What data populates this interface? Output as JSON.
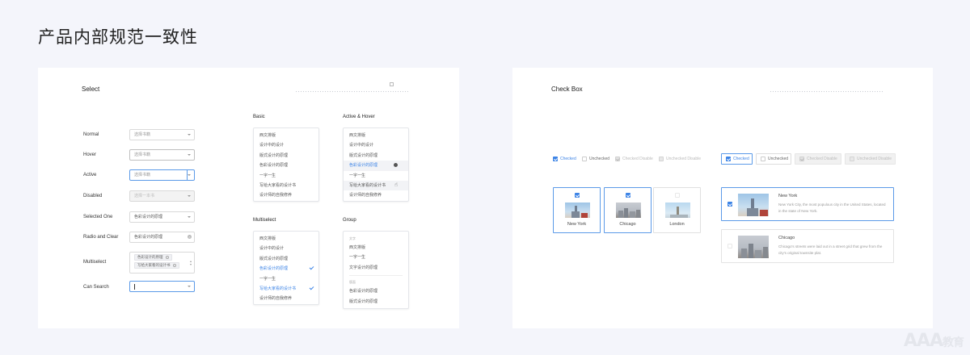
{
  "page_title": "产品内部规范一致性",
  "select_panel": {
    "title": "Select",
    "rows": [
      {
        "label": "Normal",
        "value": "选择书籍"
      },
      {
        "label": "Hover",
        "value": "选择书籍"
      },
      {
        "label": "Active",
        "value": "选择书籍"
      },
      {
        "label": "Disabled",
        "value": "选择一本书"
      },
      {
        "label": "Selected One",
        "value": "色彩设计的原理"
      },
      {
        "label": "Radio and Clear",
        "value": "色彩设计的原理"
      },
      {
        "label": "Multiselect",
        "tags": [
          "色彩设计的原理",
          "写给大家看的设计书"
        ]
      },
      {
        "label": "Can Search",
        "value": ""
      }
    ],
    "basic": {
      "title": "Basic",
      "items": [
        "西文排版",
        "设计中的设计",
        "版式设计的原理",
        "色彩设计的原理",
        "一字一生",
        "写给大家看的设计书",
        "设计师的自我修养"
      ]
    },
    "active_hover": {
      "title": "Active & Hover",
      "items": [
        "西文排版",
        "设计中的设计",
        "版式设计的原理",
        "色彩设计的原理",
        "一字一生",
        "写给大家看的设计书",
        "设计师的自我修养"
      ]
    },
    "multiselect": {
      "title": "Multiselect",
      "items": [
        "西文排版",
        "设计中的设计",
        "版式设计的原理",
        "色彩设计的原理",
        "一字一生",
        "写给大家看的设计书",
        "设计师的自我修养"
      ]
    },
    "group": {
      "title": "Group",
      "group1": {
        "name": "文字",
        "items": [
          "西文排版",
          "一字一生",
          "文字设计的原理"
        ]
      },
      "group2": {
        "name": "版面",
        "items": [
          "色彩设计的原理",
          "版式设计的原理"
        ]
      }
    }
  },
  "check_panel": {
    "title": "Check Box",
    "inline": [
      "Checked",
      "Unchecked",
      "Checked Disable",
      "Unchecked Disable"
    ],
    "boxed": [
      "Checked",
      "Unchecked",
      "Checked Disable",
      "Unchecked Disable"
    ],
    "cards": [
      "New York",
      "Chicago",
      "London"
    ],
    "wide_cards": [
      {
        "title": "New York",
        "desc": "New York City, the most populous city in the United States, located in the state of New York."
      },
      {
        "title": "Chicago",
        "desc": "Chicago's streets were laid out in a street grid that grew from the city's original townsite plat."
      }
    ]
  },
  "colors": {
    "accent": "#3d84e6",
    "background": "#f4f5fb",
    "panel": "#ffffff"
  },
  "watermark": {
    "letters": "AAA",
    "chars": "教育"
  }
}
